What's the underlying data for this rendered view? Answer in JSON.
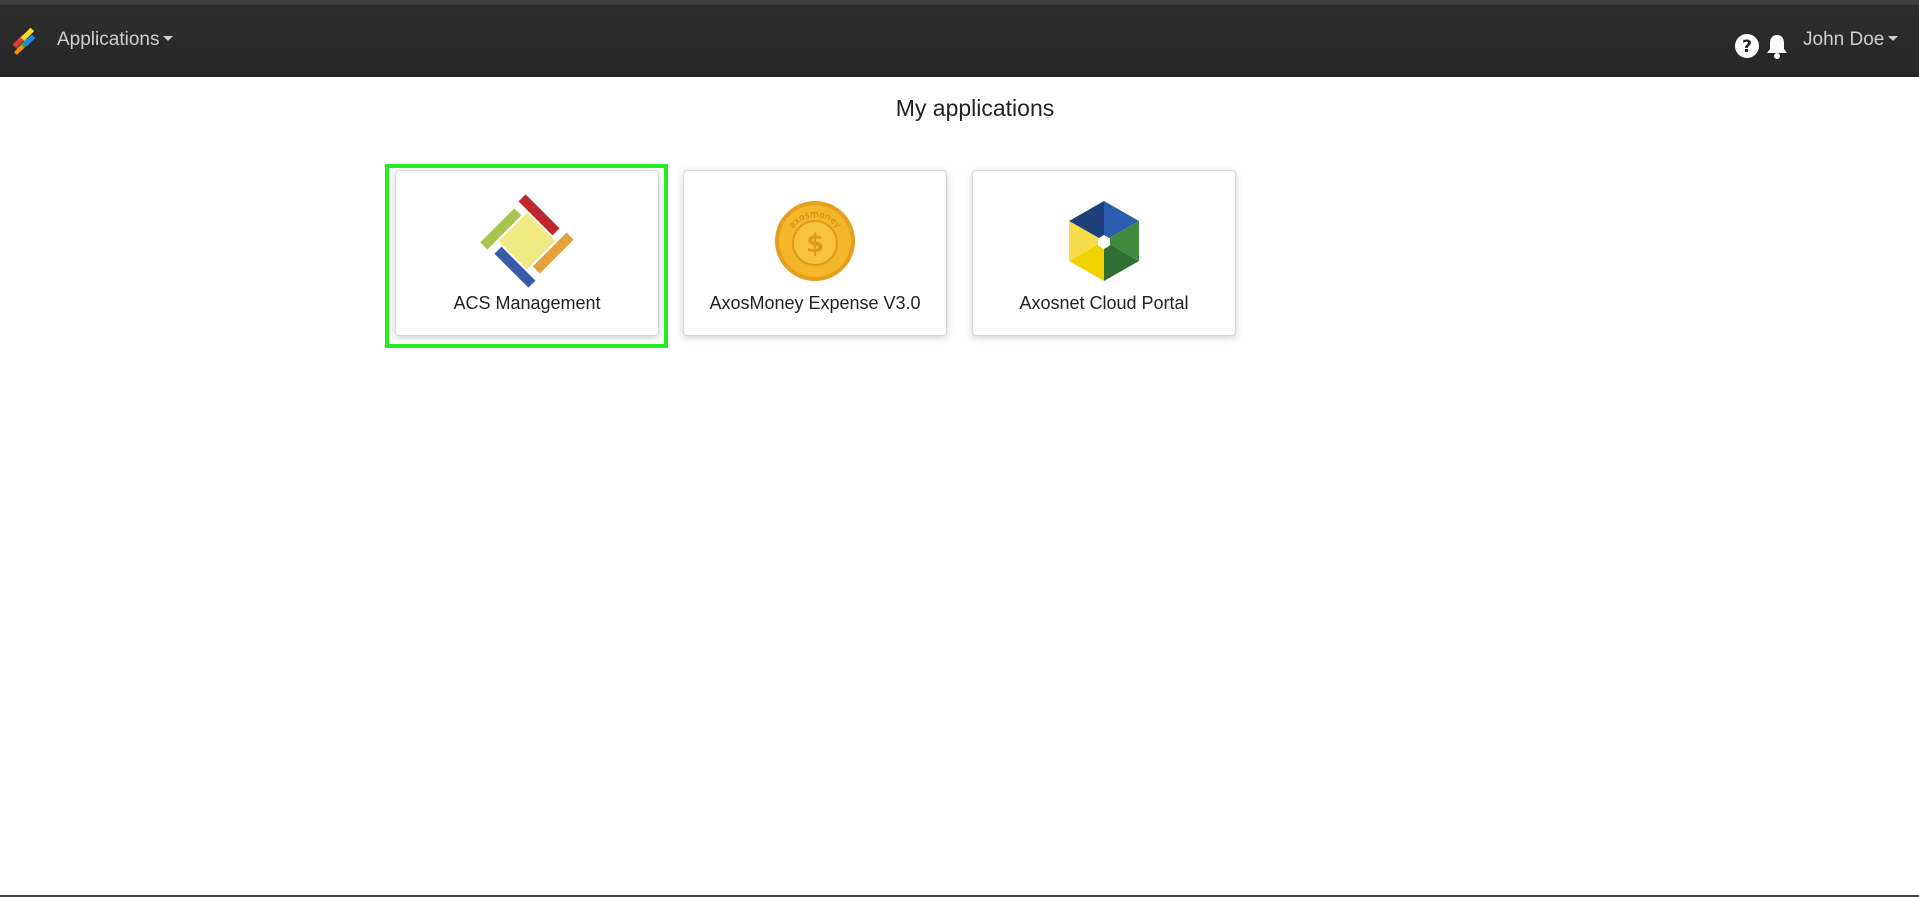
{
  "navbar": {
    "apps_menu_label": "Applications",
    "user_name": "John Doe",
    "help_icon": "help-icon",
    "notifications_icon": "bell-icon",
    "logo_icon": "app-logo-icon"
  },
  "main": {
    "title": "My applications",
    "apps": [
      {
        "label": "ACS Management",
        "icon": "acs-management-icon"
      },
      {
        "label": "AxosMoney Expense V3.0",
        "icon": "axosmoney-coin-icon",
        "icon_text": "axosmoney"
      },
      {
        "label": "Axosnet Cloud Portal",
        "icon": "cloud-portal-cube-icon"
      }
    ]
  },
  "colors": {
    "navbar_bg": "#262626",
    "highlight": "#22ee22",
    "card_border": "#d9d9d9"
  }
}
